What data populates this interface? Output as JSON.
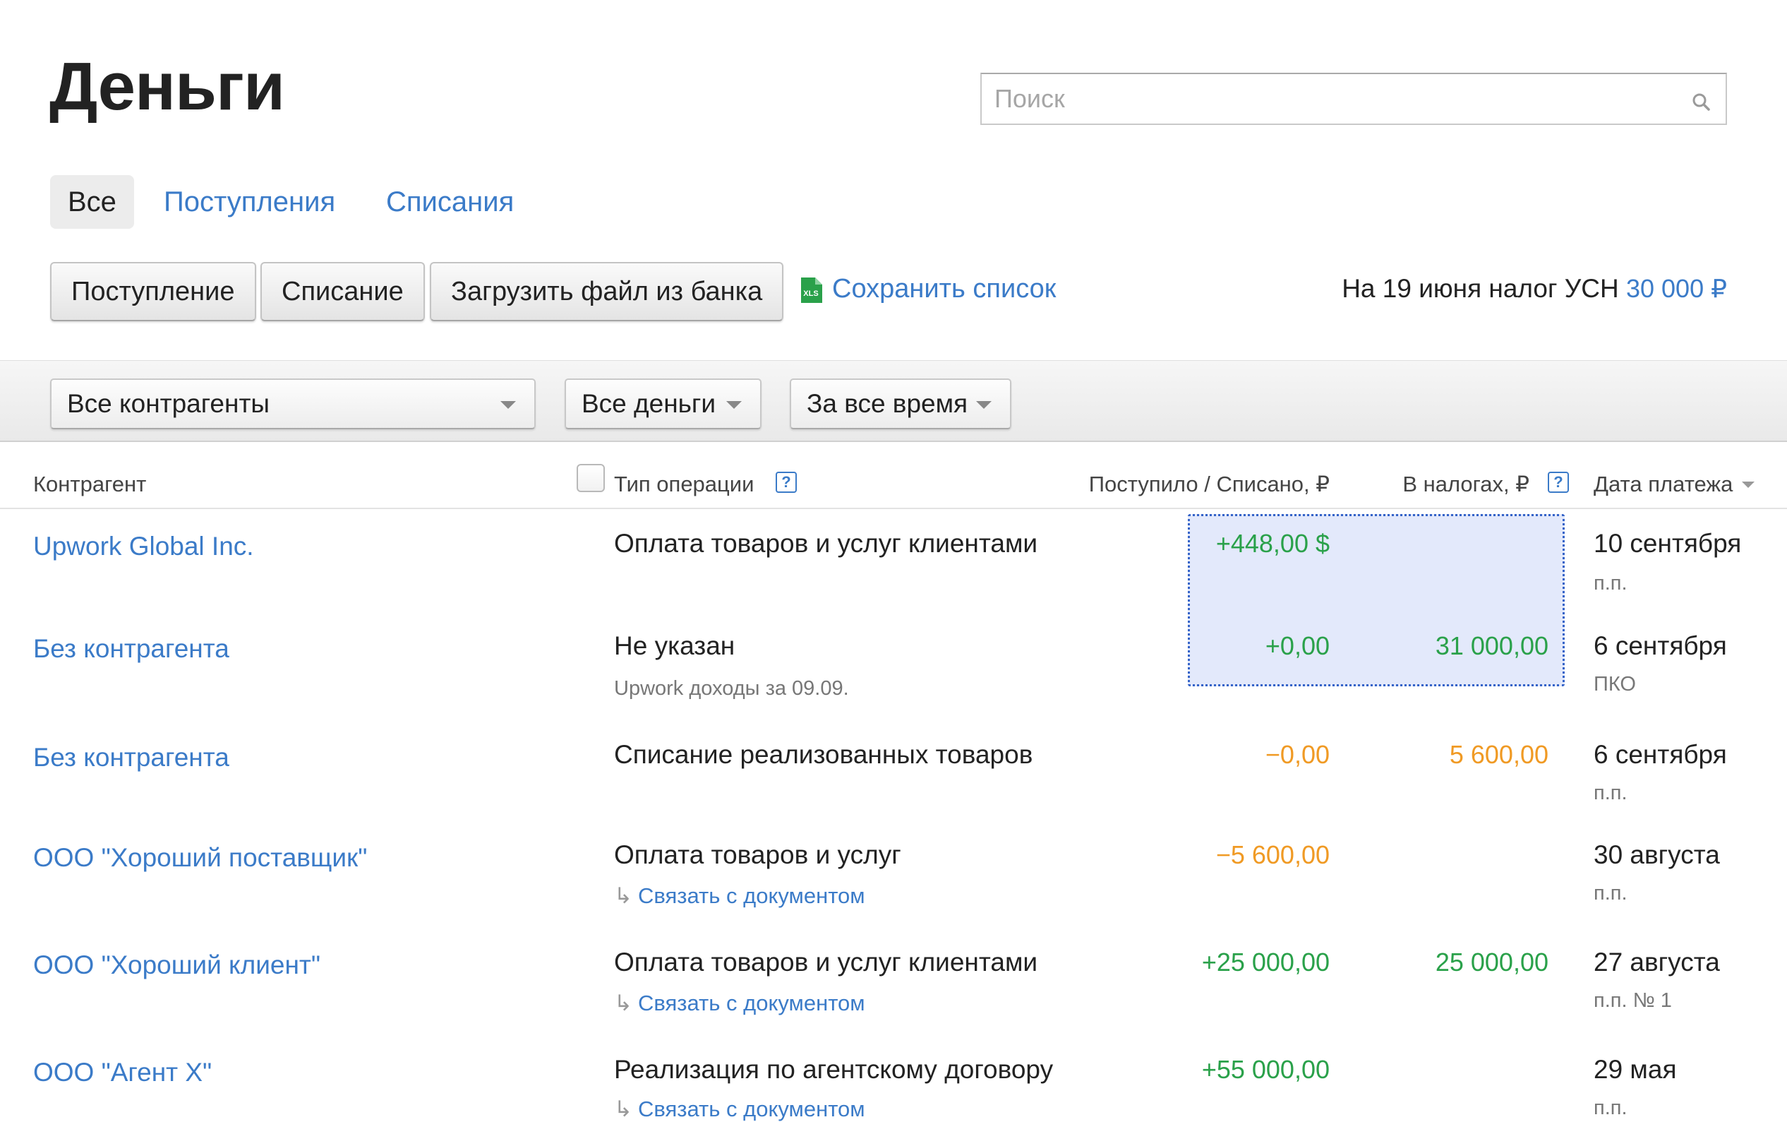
{
  "page": {
    "title": "Деньги"
  },
  "search": {
    "placeholder": "Поиск"
  },
  "tabs": [
    {
      "label": "Все",
      "active": true
    },
    {
      "label": "Поступления",
      "active": false
    },
    {
      "label": "Списания",
      "active": false
    }
  ],
  "toolbar": {
    "income_label": "Поступление",
    "expense_label": "Списание",
    "upload_label": "Загрузить файл из банка",
    "save_list_label": "Сохранить список",
    "save_list_icon": "xls-file-icon",
    "tax_text": "На 19 июня налог УСН",
    "tax_amount": "30 000 ₽"
  },
  "filters": {
    "counterparty": "Все контрагенты",
    "money": "Все деньги",
    "period": "За все время"
  },
  "columns": {
    "counterparty": "Контрагент",
    "operation_type": "Тип операции",
    "amount": "Поступило / Списано, ₽",
    "taxes": "В налогах, ₽",
    "payment_date": "Дата платежа",
    "help_symbol": "?"
  },
  "rows": [
    {
      "counterparty": "Upwork Global Inc.",
      "operation": "Оплата товаров и услуг клиентами",
      "note": "",
      "amount": "+448,00 $",
      "amount_type": "income",
      "tax": "",
      "tax_type": "",
      "date": "10 сентября",
      "doc": "п.п."
    },
    {
      "counterparty": "Без контрагента",
      "operation": "Не указан",
      "note": "Upwork доходы за 09.09.",
      "amount": "+0,00",
      "amount_type": "income",
      "tax": "31 000,00",
      "tax_type": "income",
      "date": "6 сентября",
      "doc": "ПКО"
    },
    {
      "counterparty": "Без контрагента",
      "operation": "Списание реализованных товаров",
      "note": "",
      "amount": "−0,00",
      "amount_type": "expense",
      "tax": "5 600,00",
      "tax_type": "expense",
      "date": "6 сентября",
      "doc": "п.п."
    },
    {
      "counterparty": "ООО \"Хороший поставщик\"",
      "operation": "Оплата товаров и услуг",
      "link": "Связать с документом",
      "amount": "−5 600,00",
      "amount_type": "expense",
      "tax": "",
      "tax_type": "",
      "date": "30 августа",
      "doc": "п.п."
    },
    {
      "counterparty": "ООО \"Хороший клиент\"",
      "operation": "Оплата товаров и услуг клиентами",
      "link": "Связать с документом",
      "amount": "+25 000,00",
      "amount_type": "income",
      "tax": "25 000,00",
      "tax_type": "income",
      "date": "27 августа",
      "doc": "п.п. № 1"
    },
    {
      "counterparty": "ООО \"Агент Х\"",
      "operation": "Реализация по агентскому договору",
      "link": "Связать с документом",
      "amount": "+55 000,00",
      "amount_type": "income",
      "tax": "",
      "tax_type": "",
      "date": "29 мая",
      "doc": "п.п."
    }
  ],
  "link_arrow": "↳",
  "colors": {
    "link": "#3b7bc8",
    "income": "#2aa14a",
    "expense": "#f09a24",
    "selection": "#e3e9fb"
  }
}
